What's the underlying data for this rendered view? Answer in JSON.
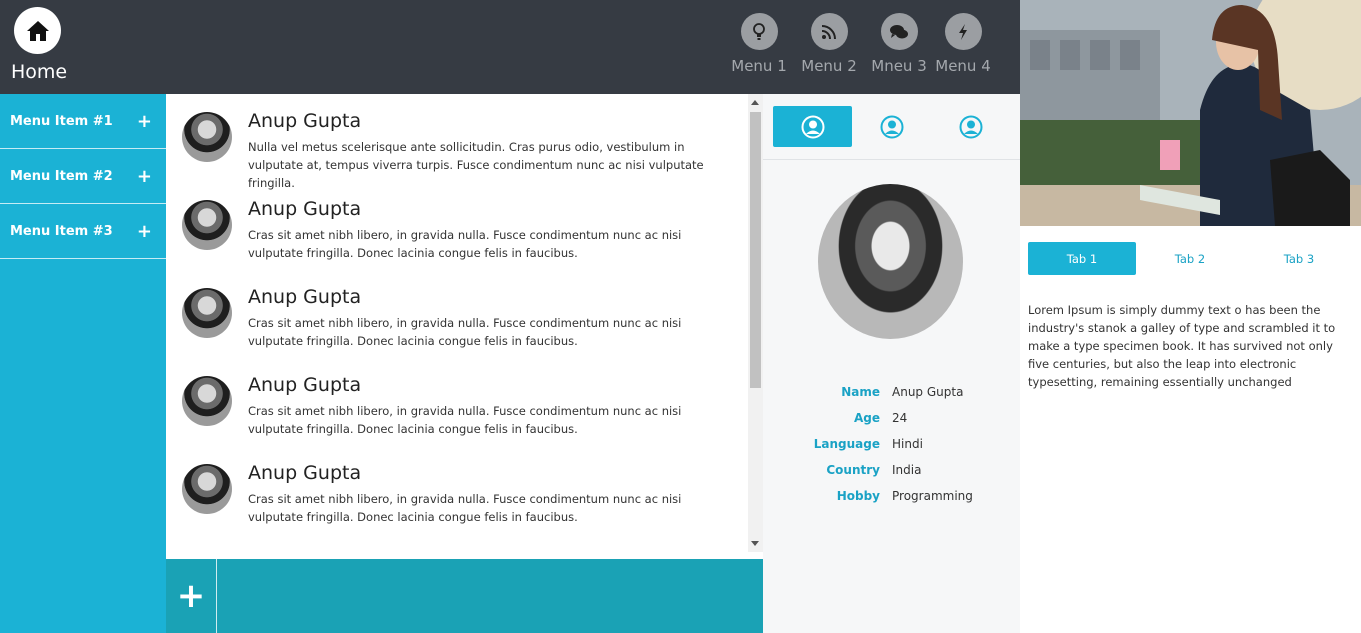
{
  "header": {
    "home_label": "Home",
    "menus": [
      {
        "label": "Menu 1",
        "icon": "lightbulb-icon"
      },
      {
        "label": "Menu 2",
        "icon": "rss-icon"
      },
      {
        "label": "Mneu 3",
        "icon": "chat-icon"
      },
      {
        "label": "Menu 4",
        "icon": "bolt-icon"
      }
    ]
  },
  "sidebar": {
    "items": [
      {
        "label": "Menu Item #1",
        "expand": "+"
      },
      {
        "label": "Menu Item #2",
        "expand": "+"
      },
      {
        "label": "Menu Item #3",
        "expand": "+"
      }
    ]
  },
  "feed": {
    "items": [
      {
        "name": "Anup Gupta",
        "text": "Nulla vel metus scelerisque ante sollicitudin. Cras purus odio, vestibulum in vulputate at, tempus viverra turpis. Fusce condimentum nunc ac nisi vulputate fringilla."
      },
      {
        "name": "Anup Gupta",
        "text": "Cras sit amet nibh libero, in gravida nulla. Fusce condimentum nunc ac nisi vulputate fringilla. Donec lacinia congue felis in faucibus."
      },
      {
        "name": "Anup Gupta",
        "text": "Cras sit amet nibh libero, in gravida nulla. Fusce condimentum nunc ac nisi vulputate fringilla. Donec lacinia congue felis in faucibus."
      },
      {
        "name": "Anup Gupta",
        "text": "Cras sit amet nibh libero, in gravida nulla. Fusce condimentum nunc ac nisi vulputate fringilla. Donec lacinia congue felis in faucibus."
      },
      {
        "name": "Anup Gupta",
        "text": "Cras sit amet nibh libero, in gravida nulla. Fusce condimentum nunc ac nisi vulputate fringilla. Donec lacinia congue felis in faucibus."
      }
    ],
    "add_label": "+"
  },
  "profile": {
    "fields": [
      {
        "label": "Name",
        "value": "Anup Gupta"
      },
      {
        "label": "Age",
        "value": "24"
      },
      {
        "label": "Language",
        "value": "Hindi"
      },
      {
        "label": "Country",
        "value": "India"
      },
      {
        "label": "Hobby",
        "value": "Programming"
      }
    ]
  },
  "right_panel": {
    "tabs": [
      "Tab 1",
      "Tab 2",
      "Tab 3"
    ],
    "active_tab": "Tab 1",
    "text": "Lorem Ipsum is simply dummy text o has been the industry's stanok a galley of type and scrambled it to make a type specimen book. It has survived not only five centuries, but also the leap into electronic typesetting, remaining essentially unchanged"
  },
  "colors": {
    "accent": "#1bb2d5",
    "header_bg": "#363b43",
    "bottom_bar": "#1aa2b5"
  }
}
